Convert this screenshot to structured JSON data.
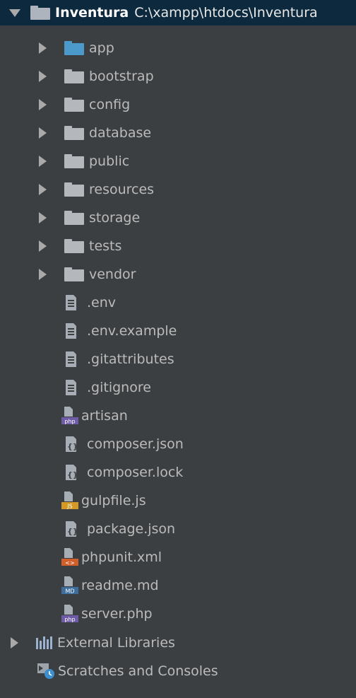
{
  "project": {
    "name": "Inventura",
    "path": "C:\\xampp\\htdocs\\Inventura"
  },
  "folders": [
    {
      "label": "app",
      "icon": "folder-blue-icon"
    },
    {
      "label": "bootstrap",
      "icon": "folder-icon"
    },
    {
      "label": "config",
      "icon": "folder-icon"
    },
    {
      "label": "database",
      "icon": "folder-icon"
    },
    {
      "label": "public",
      "icon": "folder-icon"
    },
    {
      "label": "resources",
      "icon": "folder-icon"
    },
    {
      "label": "storage",
      "icon": "folder-icon"
    },
    {
      "label": "tests",
      "icon": "folder-icon"
    },
    {
      "label": "vendor",
      "icon": "folder-icon"
    }
  ],
  "files": [
    {
      "label": ".env",
      "icon": "text-file-icon"
    },
    {
      "label": ".env.example",
      "icon": "text-file-icon"
    },
    {
      "label": ".gitattributes",
      "icon": "text-file-icon"
    },
    {
      "label": ".gitignore",
      "icon": "text-file-icon"
    },
    {
      "label": "artisan",
      "icon": "php-file-icon",
      "badge": "php"
    },
    {
      "label": "composer.json",
      "icon": "json-file-icon"
    },
    {
      "label": "composer.lock",
      "icon": "json-file-icon"
    },
    {
      "label": "gulpfile.js",
      "icon": "js-file-icon",
      "badge": "JS"
    },
    {
      "label": "package.json",
      "icon": "json-file-icon"
    },
    {
      "label": "phpunit.xml",
      "icon": "xml-file-icon",
      "badge": "<>"
    },
    {
      "label": "readme.md",
      "icon": "md-file-icon",
      "badge": "MD"
    },
    {
      "label": "server.php",
      "icon": "php-file-icon",
      "badge": "php"
    }
  ],
  "external_libraries": {
    "label": "External Libraries",
    "icon": "libraries-icon"
  },
  "scratches": {
    "label": "Scratches and Consoles",
    "icon": "scratches-icon"
  },
  "colors": {
    "background": "#3c3f41",
    "selection": "#0d293e",
    "text": "#bbbbbb",
    "folder_blue": "#4c9acb",
    "php_badge": "#6e5ca8",
    "js_badge": "#d49a25",
    "xml_badge": "#d25f2a",
    "md_badge": "#3d6e9e"
  }
}
